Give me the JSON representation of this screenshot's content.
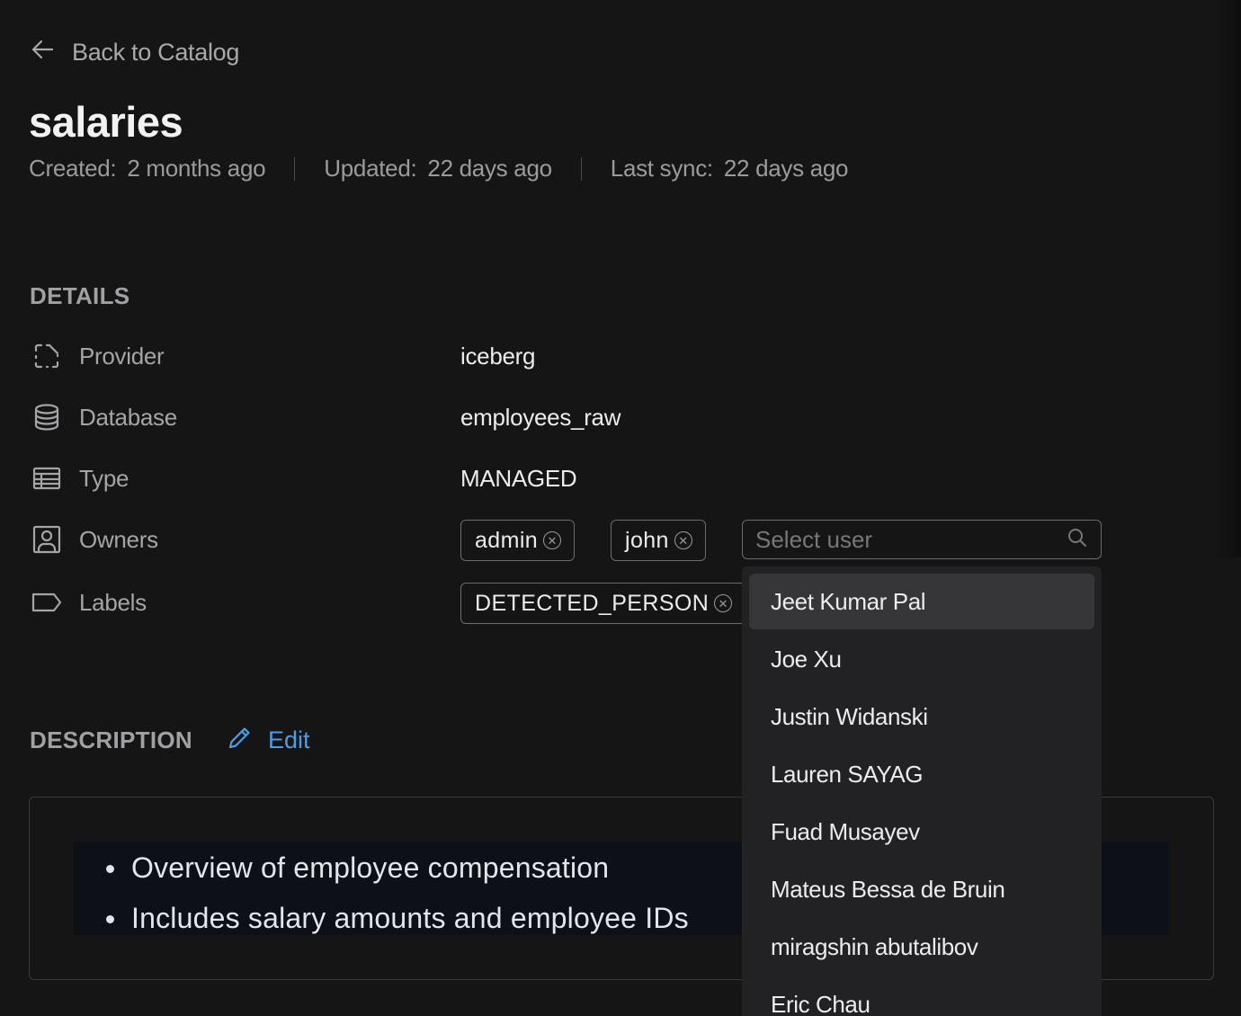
{
  "nav": {
    "back_label": "Back to Catalog"
  },
  "table": {
    "name": "salaries"
  },
  "meta": {
    "created_label": "Created:",
    "created_value": "2 months ago",
    "updated_label": "Updated:",
    "updated_value": "22 days ago",
    "sync_label": "Last sync:",
    "sync_value": "22 days ago"
  },
  "details": {
    "heading": "DETAILS",
    "provider": {
      "label": "Provider",
      "value": "iceberg",
      "icon": "provider-icon"
    },
    "database": {
      "label": "Database",
      "value": "employees_raw",
      "icon": "database-icon"
    },
    "type": {
      "label": "Type",
      "value": "MANAGED",
      "icon": "table-icon"
    },
    "owners": {
      "label": "Owners",
      "icon": "user-square-icon",
      "tags": [
        "admin",
        "john"
      ]
    },
    "labels": {
      "label": "Labels",
      "icon": "tag-icon",
      "tags": [
        "DETECTED_PERSON"
      ]
    }
  },
  "user_select": {
    "placeholder": "Select user",
    "options": [
      "Jeet Kumar Pal",
      "Joe Xu",
      "Justin Widanski",
      "Lauren SAYAG",
      "Fuad Musayev",
      "Mateus Bessa de Bruin",
      "miragshin abutalibov",
      "Eric Chau"
    ],
    "highlighted_index": 0
  },
  "description": {
    "heading": "DESCRIPTION",
    "edit_label": "Edit",
    "bullets": [
      "Overview of employee compensation",
      "Includes salary amounts and employee IDs"
    ]
  },
  "colors": {
    "accent": "#4d9de8",
    "background": "#151516"
  }
}
